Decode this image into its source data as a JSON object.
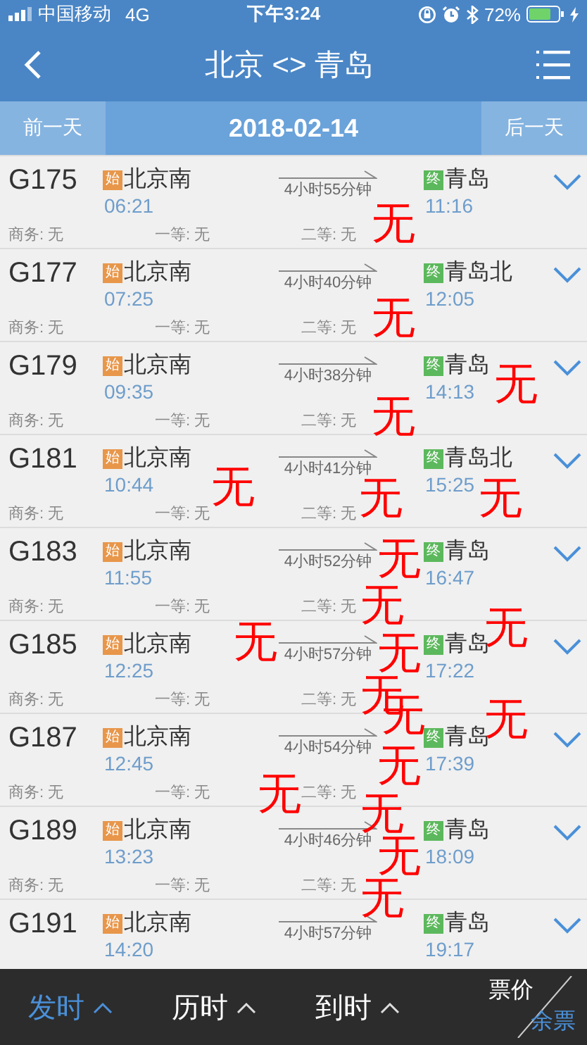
{
  "status_bar": {
    "carrier": "中国移动",
    "network": "4G",
    "time": "下午3:24",
    "battery": "72%"
  },
  "nav": {
    "title": "北京 <> 青岛"
  },
  "date_bar": {
    "prev": "前一天",
    "date": "2018-02-14",
    "next": "后一天"
  },
  "trains": [
    {
      "number": "G175",
      "from_badge": "始",
      "from": "北京南",
      "depart": "06:21",
      "duration": "4小时55分钟",
      "to_badge": "终",
      "to": "青岛",
      "arrive": "11:16",
      "seats": [
        "商务: 无",
        "一等: 无",
        "二等: 无"
      ]
    },
    {
      "number": "G177",
      "from_badge": "始",
      "from": "北京南",
      "depart": "07:25",
      "duration": "4小时40分钟",
      "to_badge": "终",
      "to": "青岛北",
      "arrive": "12:05",
      "seats": [
        "商务: 无",
        "一等: 无",
        "二等: 无"
      ]
    },
    {
      "number": "G179",
      "from_badge": "始",
      "from": "北京南",
      "depart": "09:35",
      "duration": "4小时38分钟",
      "to_badge": "终",
      "to": "青岛",
      "arrive": "14:13",
      "seats": [
        "商务: 无",
        "一等: 无",
        "二等: 无"
      ]
    },
    {
      "number": "G181",
      "from_badge": "始",
      "from": "北京南",
      "depart": "10:44",
      "duration": "4小时41分钟",
      "to_badge": "终",
      "to": "青岛北",
      "arrive": "15:25",
      "seats": [
        "商务: 无",
        "一等: 无",
        "二等: 无"
      ]
    },
    {
      "number": "G183",
      "from_badge": "始",
      "from": "北京南",
      "depart": "11:55",
      "duration": "4小时52分钟",
      "to_badge": "终",
      "to": "青岛",
      "arrive": "16:47",
      "seats": [
        "商务: 无",
        "一等: 无",
        "二等: 无"
      ]
    },
    {
      "number": "G185",
      "from_badge": "始",
      "from": "北京南",
      "depart": "12:25",
      "duration": "4小时57分钟",
      "to_badge": "终",
      "to": "青岛",
      "arrive": "17:22",
      "seats": [
        "商务: 无",
        "一等: 无",
        "二等: 无"
      ]
    },
    {
      "number": "G187",
      "from_badge": "始",
      "from": "北京南",
      "depart": "12:45",
      "duration": "4小时54分钟",
      "to_badge": "终",
      "to": "青岛",
      "arrive": "17:39",
      "seats": [
        "商务: 无",
        "一等: 无",
        "二等: 无"
      ]
    },
    {
      "number": "G189",
      "from_badge": "始",
      "from": "北京南",
      "depart": "13:23",
      "duration": "4小时46分钟",
      "to_badge": "终",
      "to": "青岛",
      "arrive": "18:09",
      "seats": [
        "商务: 无",
        "一等: 无",
        "二等: 无"
      ]
    },
    {
      "number": "G191",
      "from_badge": "始",
      "from": "北京南",
      "depart": "14:20",
      "duration": "4小时57分钟",
      "to_badge": "终",
      "to": "青岛",
      "arrive": "19:17"
    }
  ],
  "sort_bar": {
    "items": [
      {
        "label": "发时",
        "selected": true
      },
      {
        "label": "历时",
        "selected": false
      },
      {
        "label": "到时",
        "selected": false
      }
    ],
    "toggle": [
      {
        "label": "票价",
        "selected": false
      },
      {
        "label": "余票",
        "selected": true
      }
    ]
  },
  "overlay_marks": [
    "无",
    "无",
    "无",
    "无",
    "无",
    "无",
    "无",
    "无",
    "无",
    "无",
    "无",
    "无",
    "无",
    "无",
    "无",
    "无",
    "无",
    "无",
    "无",
    "无"
  ]
}
